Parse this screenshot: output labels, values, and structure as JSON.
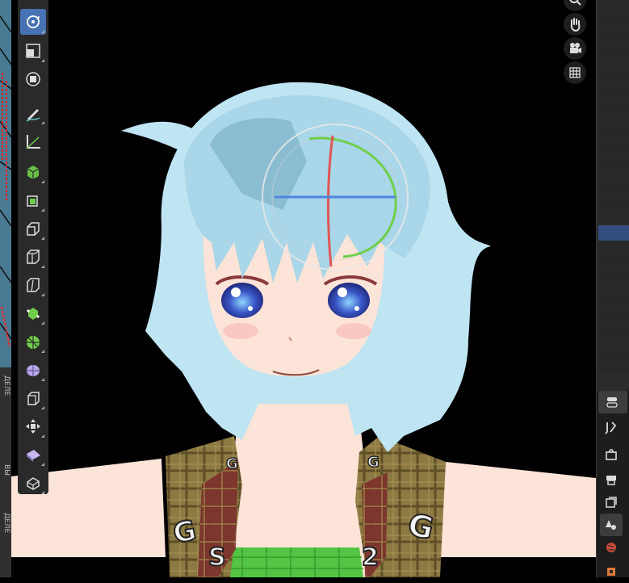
{
  "app": "Blender 3D Viewport",
  "colors": {
    "active_tool": "#4772b3",
    "hair": "#bfe4f2",
    "skin": "#fde4d8",
    "vest": "#8a7540",
    "shirt": "#53c444",
    "gizmo_x": "#e05555",
    "gizmo_y": "#6fcf4a",
    "gizmo_z": "#4f86df"
  },
  "toolbar": {
    "tools": [
      {
        "name": "select-box-tool",
        "icon": "select-box-icon"
      },
      {
        "name": "rotate-tool",
        "icon": "rotate-icon",
        "active": true
      },
      {
        "name": "scale-tool",
        "icon": "scale-icon"
      },
      {
        "name": "transform-tool",
        "icon": "transform-icon"
      },
      {
        "name": "annotate-tool",
        "icon": "annotate-icon"
      },
      {
        "name": "measure-tool",
        "icon": "measure-icon"
      },
      {
        "name": "add-cube-tool",
        "icon": "add-cube-icon"
      },
      {
        "name": "extrude-region-tool",
        "icon": "extrude-icon"
      },
      {
        "name": "inset-faces-tool",
        "icon": "inset-icon"
      },
      {
        "name": "bevel-tool",
        "icon": "bevel-icon"
      },
      {
        "name": "loop-cut-tool",
        "icon": "loop-cut-icon"
      },
      {
        "name": "knife-tool",
        "icon": "knife-icon"
      },
      {
        "name": "poly-build-tool",
        "icon": "poly-build-icon"
      },
      {
        "name": "spin-tool",
        "icon": "spin-icon"
      },
      {
        "name": "smooth-tool",
        "icon": "smooth-icon"
      },
      {
        "name": "edge-slide-tool",
        "icon": "edge-slide-icon"
      },
      {
        "name": "shrink-fatten-tool",
        "icon": "shrink-fatten-icon"
      },
      {
        "name": "shear-tool",
        "icon": "shear-icon"
      },
      {
        "name": "rip-region-tool",
        "icon": "rip-icon"
      }
    ]
  },
  "navigation": [
    "zoom-icon",
    "hand-pan-icon",
    "camera-view-icon",
    "grid-ortho-icon"
  ],
  "properties_tabs": [
    "tool-tab",
    "render-tab",
    "output-tab",
    "view-layer-tab",
    "scene-tab",
    "world-tab",
    "object-tab"
  ],
  "vest_letters": [
    "G",
    "G",
    "G",
    "G",
    "S",
    "2"
  ]
}
